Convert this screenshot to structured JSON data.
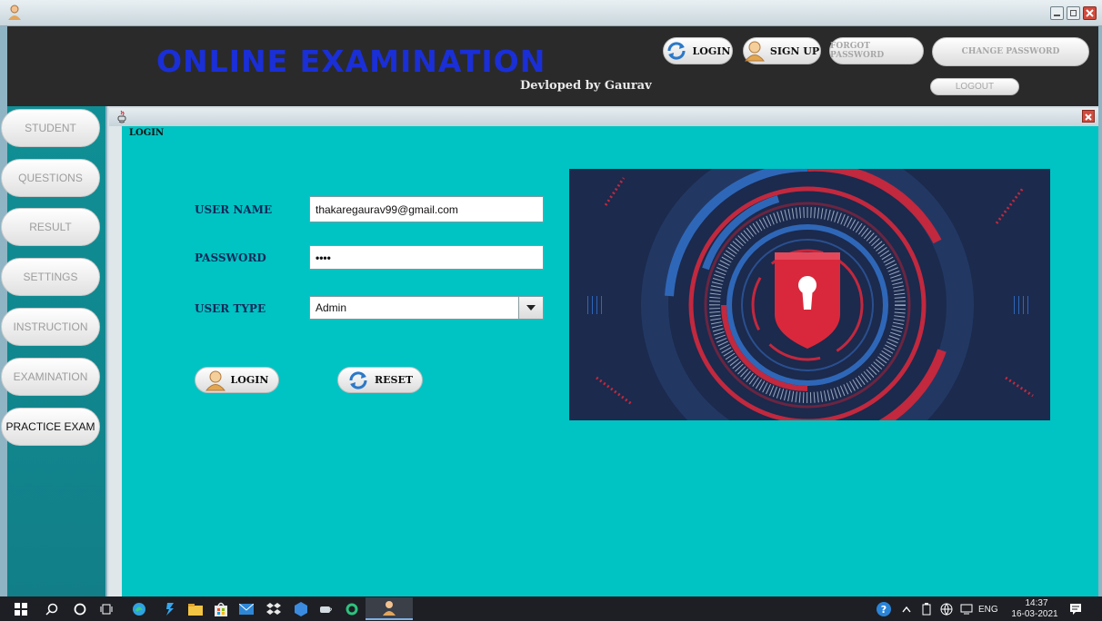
{
  "window": {
    "title": ""
  },
  "header": {
    "app_title": "ONLINE EXAMINATION",
    "developer_credit": "Devloped by Gaurav",
    "buttons": {
      "login": "LOGIN",
      "sign_up": "SIGN UP",
      "forgot_password": "FORGOT PASSWORD",
      "change_password": "CHANGE PASSWORD",
      "logout": "LOGOUT"
    }
  },
  "sidebar": {
    "items": [
      {
        "label": "STUDENT",
        "enabled": false
      },
      {
        "label": "QUESTIONS",
        "enabled": false
      },
      {
        "label": "RESULT",
        "enabled": false
      },
      {
        "label": "SETTINGS",
        "enabled": false
      },
      {
        "label": "INSTRUCTION",
        "enabled": false
      },
      {
        "label": "EXAMINATION",
        "enabled": false
      },
      {
        "label": "PRACTICE EXAM",
        "enabled": true
      }
    ]
  },
  "login_panel": {
    "title": "LOGIN",
    "username": {
      "label": "USER NAME",
      "value": "thakaregaurav99@gmail.com"
    },
    "password": {
      "label": "PASSWORD",
      "value": "••••"
    },
    "user_type": {
      "label": "USER TYPE",
      "value": "Admin"
    },
    "login_button": "LOGIN",
    "reset_button": "RESET",
    "image": "padlock-shield-security-image"
  },
  "taskbar": {
    "language": "ENG",
    "time": "14:37",
    "date": "16-03-2021"
  },
  "colors": {
    "content_bg": "#00c3c3",
    "sidebar_bg": "#0f8f95",
    "header_bg": "#2a2a2a",
    "title_blue": "#1a2fd6",
    "lock_red": "#d9283b"
  }
}
